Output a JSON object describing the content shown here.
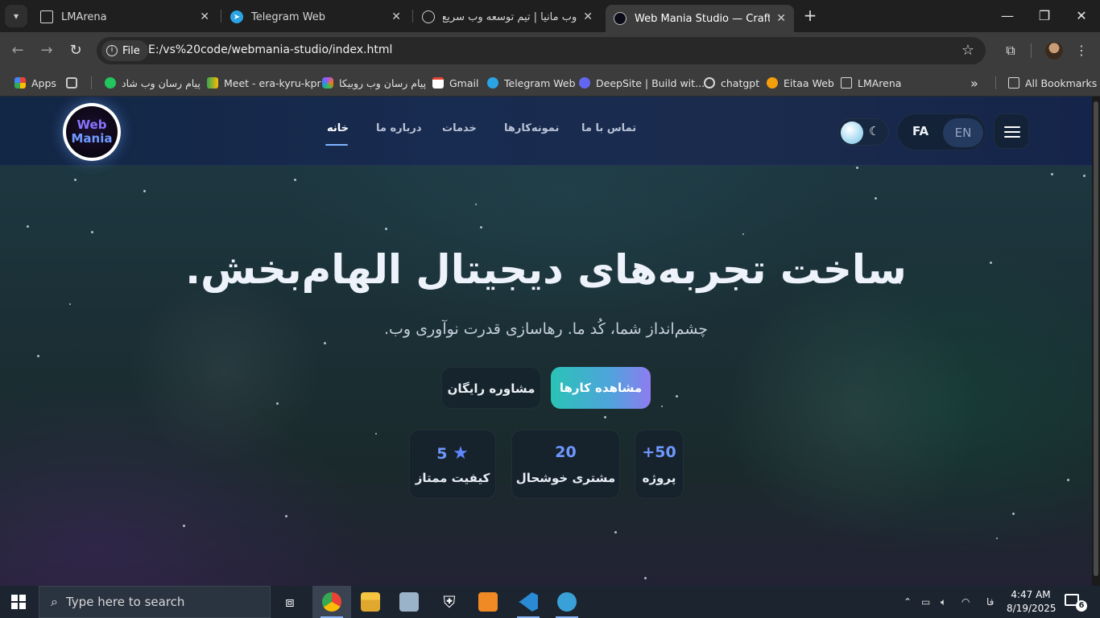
{
  "browser": {
    "tabs": [
      {
        "title": "LMArena",
        "active": false
      },
      {
        "title": "Telegram Web",
        "active": false
      },
      {
        "title": "وب مانیا | تیم توسعه وب سریع و",
        "active": false
      },
      {
        "title": "Web Mania Studio — Crafting D",
        "active": true
      }
    ],
    "new_tab": "+",
    "address": {
      "scheme_label": "File",
      "url": "E:/vs%20code/webmania-studio/index.html"
    },
    "bookmarks": [
      {
        "label": "Apps",
        "icon": "apps-icon",
        "color": "#ea4335"
      },
      {
        "label": "",
        "icon": "grid-icon",
        "color": "#c9c9c9"
      },
      {
        "label": "پیام رسان وب شاد",
        "icon": "shad-icon",
        "color": "#22c55e"
      },
      {
        "label": "Meet - era-kyru-kpr",
        "icon": "meet-icon",
        "color": "#34a853"
      },
      {
        "label": "پیام رسان وب روبیکا",
        "icon": "rubika-icon",
        "color": "#a855f7"
      },
      {
        "label": "Gmail",
        "icon": "gmail-icon",
        "color": "#ea4335"
      },
      {
        "label": "Telegram Web",
        "icon": "telegram-icon",
        "color": "#2aa4e4"
      },
      {
        "label": "DeepSite | Build wit...",
        "icon": "deepsite-icon",
        "color": "#6366f1"
      },
      {
        "label": "chatgpt",
        "icon": "chatgpt-icon",
        "color": "#d8d8d8"
      },
      {
        "label": "Eitaa Web",
        "icon": "eitaa-icon",
        "color": "#f59e0b"
      },
      {
        "label": "LMArena",
        "icon": "lmarena-icon",
        "color": "#d8d8d8"
      }
    ],
    "more_bookmarks": "»",
    "all_bookmarks": "All Bookmarks"
  },
  "site": {
    "logo": {
      "line1": "Web",
      "line2": "Mania"
    },
    "menu": [
      {
        "label": "خانه",
        "active": true
      },
      {
        "label": "درباره ما",
        "active": false
      },
      {
        "label": "خدمات",
        "active": false
      },
      {
        "label": "نمونه‌کارها",
        "active": false
      },
      {
        "label": "تماس با ما",
        "active": false
      }
    ],
    "lang": {
      "fa": "FA",
      "en": "EN"
    },
    "theme_icon": "moon-icon",
    "hero": {
      "title": "ساخت تجربه‌های دیجیتال الهام‌بخش.",
      "subtitle": "چشم‌انداز شما، کُد ما. رهاسازی قدرت نوآوری وب.",
      "primary_cta": "مشاهده کارها",
      "secondary_cta": "مشاوره رایگان"
    },
    "stats": [
      {
        "value": "5",
        "label": "کیفیت ممتاز",
        "icon": "star-icon"
      },
      {
        "value": "20",
        "label": "مشتری خوشحال"
      },
      {
        "value": "+50",
        "label": "پروژه"
      }
    ]
  },
  "taskbar": {
    "search_placeholder": "Type here to search",
    "lang_indicator": "فا",
    "time": "4:47 AM",
    "date": "8/19/2025",
    "notification_count": "6"
  },
  "colors": {
    "accent_gradient_start": "#2ac3b6",
    "accent_gradient_end": "#8f7cf0",
    "stat_number": "#6f98ff",
    "menu_underline": "#7fb3ff"
  }
}
